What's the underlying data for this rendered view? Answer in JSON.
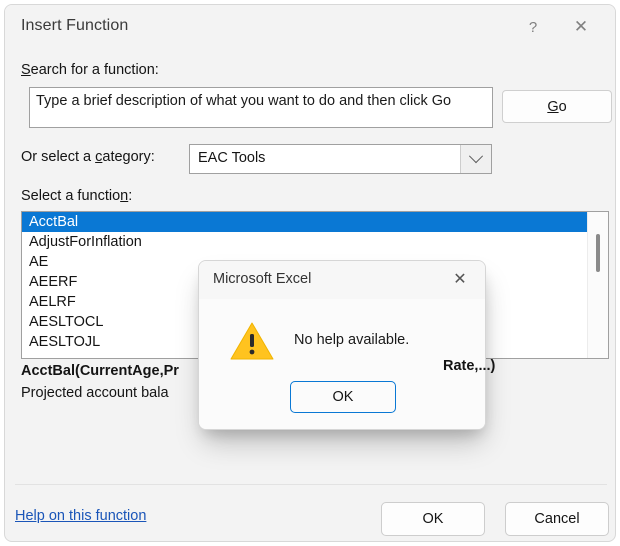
{
  "window": {
    "title": "Insert Function",
    "help_icon": "question-mark-icon",
    "close_icon": "close-icon"
  },
  "search": {
    "label_prefix": "S",
    "label_rest": "earch for a function:",
    "value": "Type a brief description of what you want to do and then click Go",
    "go_prefix": "G",
    "go_rest": "o"
  },
  "category": {
    "label_prefix": "Or select a ",
    "label_accel": "c",
    "label_rest": "ategory:",
    "selected": "EAC Tools"
  },
  "functions": {
    "label_prefix": "Select a functio",
    "label_accel": "n",
    "label_rest": ":",
    "items": [
      "AcctBal",
      "AdjustForInflation",
      "AE",
      "AEERF",
      "AELRF",
      "AESLTOCL",
      "AESLTOJL"
    ],
    "selected_index": 0,
    "signature": "AcctBal(CurrentAge,Pr",
    "signature_tail": "Rate,...)",
    "description": "Projected account bala"
  },
  "footer": {
    "help_link": "Help on this function",
    "ok_label": "OK",
    "cancel_label": "Cancel"
  },
  "modal": {
    "title": "Microsoft Excel",
    "close_icon": "close-icon",
    "warning_icon": "warning-triangle-icon",
    "message": "No help available.",
    "ok_label": "OK"
  },
  "colors": {
    "accent": "#0a78d4",
    "warning": "#ffc31f",
    "link": "#1a55b8",
    "window_bg": "#f3f3f3"
  }
}
